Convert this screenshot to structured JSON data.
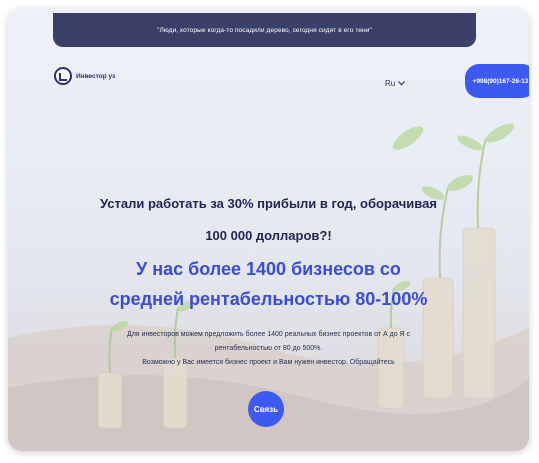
{
  "topbar": {
    "quote": "\"Люди, которые когда-то посадили дерево, сегодня сидят в его тени\""
  },
  "header": {
    "logo_text": "Инвестор уз",
    "language": "Ru",
    "phone": "+998(90)167-26-13"
  },
  "hero": {
    "subtitle": "Устали работать за 30% прибыли в год, оборачивая 100 000 долларов?!",
    "title": "У нас более 1400 бизнесов со средней рентабельностью 80-100%",
    "description_1": "Для инвесторов можем предложить более 1400 реальных бизнес проектов от А до Я с рентабельностью от 80 до 500%.",
    "description_2": "Возможно у Вас имеется бизнес проект и Вам нужен инвестор. Обращайтесь",
    "cta": "Связь"
  },
  "colors": {
    "topbar_bg": "#3b4068",
    "accent": "#3d5af0",
    "title_blue": "#3a4cd8",
    "text_dark": "#1e2552"
  }
}
